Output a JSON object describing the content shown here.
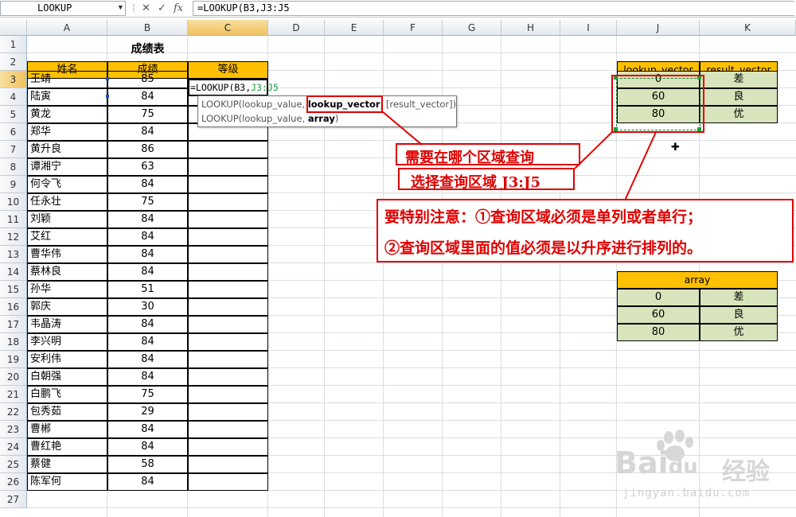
{
  "formula_bar": {
    "name_box": "LOOKUP",
    "formula": "=LOOKUP(B3,J3:J5",
    "fx_label": "fx"
  },
  "columns": [
    "A",
    "B",
    "C",
    "D",
    "E",
    "F",
    "G",
    "H",
    "I",
    "J",
    "K"
  ],
  "rows": [
    "1",
    "2",
    "3",
    "4",
    "5",
    "6",
    "7",
    "8",
    "9",
    "10",
    "11",
    "12",
    "13",
    "14",
    "15",
    "16",
    "17",
    "18",
    "19",
    "20",
    "21",
    "22",
    "23",
    "24",
    "25",
    "26",
    "27"
  ],
  "sheet": {
    "title": "成绩表",
    "headers": {
      "name": "姓名",
      "score": "成绩",
      "grade": "等级"
    },
    "students": [
      {
        "name": "王靖",
        "score": "85"
      },
      {
        "name": "陆寅",
        "score": "84"
      },
      {
        "name": "黄龙",
        "score": "75"
      },
      {
        "name": "郑华",
        "score": "84"
      },
      {
        "name": "黄升良",
        "score": "86"
      },
      {
        "name": "谭湘宁",
        "score": "63"
      },
      {
        "name": "何令飞",
        "score": "84"
      },
      {
        "name": "任永壮",
        "score": "75"
      },
      {
        "name": "刘颖",
        "score": "84"
      },
      {
        "name": "艾红",
        "score": "84"
      },
      {
        "name": "曹华伟",
        "score": "84"
      },
      {
        "name": "蔡林良",
        "score": "84"
      },
      {
        "name": "孙华",
        "score": "51"
      },
      {
        "name": "郭庆",
        "score": "30"
      },
      {
        "name": "韦晶涛",
        "score": "84"
      },
      {
        "name": "李兴明",
        "score": "84"
      },
      {
        "name": "安利伟",
        "score": "84"
      },
      {
        "name": "白朝强",
        "score": "84"
      },
      {
        "name": "白鹏飞",
        "score": "75"
      },
      {
        "name": "包秀茹",
        "score": "29"
      },
      {
        "name": "曹郴",
        "score": "84"
      },
      {
        "name": "曹红艳",
        "score": "84"
      },
      {
        "name": "蔡健",
        "score": "58"
      },
      {
        "name": "陈军何",
        "score": "84"
      }
    ],
    "c3_edit": {
      "prefix": "=LOOKUP(B3,",
      "ref": "J3:J5"
    }
  },
  "tooltip": {
    "line1_a": "LOOKUP(lookup_value, ",
    "line1_b": "lookup_vector",
    "line1_c": ", [result_vector])",
    "line2_a": "LOOKUP(lookup_value, ",
    "line2_b": "array",
    "line2_c": ")"
  },
  "vector_table": {
    "headers": [
      "lookup_vector",
      "result_vector"
    ],
    "rows": [
      [
        "0",
        "差"
      ],
      [
        "60",
        "良"
      ],
      [
        "80",
        "优"
      ]
    ]
  },
  "array_table": {
    "header": "array",
    "rows": [
      [
        "0",
        "差"
      ],
      [
        "60",
        "良"
      ],
      [
        "80",
        "优"
      ]
    ]
  },
  "annotations": {
    "note1": "需要在哪个区域查询",
    "note2": "选择查询区域 J3:J5",
    "note3": "要特别注意：①查询区域必须是单列或者单行；",
    "note4": "②查询区域里面的值必须是以升序进行排列的。"
  },
  "watermark": {
    "brand": "Bai",
    "brand2": "du",
    "cn": "经验",
    "url": "jingyan.baidu.com"
  },
  "colors": {
    "header_orange": "#ffc000",
    "vector_green": "#d8e4bc",
    "annotation_red": "#e00000",
    "ref_green": "#1e9e3e"
  }
}
